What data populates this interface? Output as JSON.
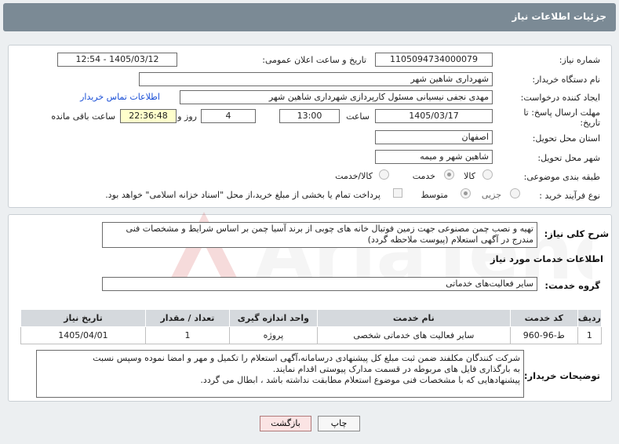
{
  "header": {
    "title": "جزئیات اطلاعات نیاز"
  },
  "fields": {
    "need_number_label": "شماره نیاز:",
    "need_number": "1105094734000079",
    "announce_label": "تاریخ و ساعت اعلان عمومی:",
    "announce_value": "1405/03/12 - 12:54",
    "buyer_org_label": "نام دستگاه خریدار:",
    "buyer_org": "شهرداری شاهین شهر",
    "creator_label": "ایجاد کننده درخواست:",
    "creator": "مهدی نجفی نیسیانی مسئول کارپردازی شهرداری شاهین شهر",
    "contact_link": "اطلاعات تماس خریدار",
    "deadline_label": "مهلت ارسال پاسخ: تا تاریخ:",
    "deadline_date": "1405/03/17",
    "time_label": "ساعت",
    "deadline_time": "13:00",
    "days_value": "4",
    "days_label": "روز و",
    "remaining_time": "22:36:48",
    "remaining_label": "ساعت باقی مانده",
    "province_label": "استان محل تحویل:",
    "province": "اصفهان",
    "city_label": "شهر محل تحویل:",
    "city": "شاهین شهر و میمه",
    "category_label": "طبقه بندی موضوعی:",
    "category_options": [
      "کالا",
      "خدمت",
      "کالا/خدمت"
    ],
    "category_selected": "خدمت",
    "process_label": "نوع فرآیند خرید :",
    "process_options": [
      "جزیی",
      "متوسط"
    ],
    "process_selected": "متوسط",
    "treasury_note": "پرداخت تمام یا بخشی از مبلغ خرید،از محل \"اسناد خزانه اسلامی\" خواهد بود."
  },
  "summary": {
    "label": "شرح کلی نیاز:",
    "text": "تهیه و نصب چمن مصنوعی جهت زمین فوتبال خانه های چوبی از برند آسیا چمن بر اساس شرایط و مشخصات فنی مندرج در آگهی استعلام (پیوست ملاحظه گردد)"
  },
  "services": {
    "section_title": "اطلاعات خدمات مورد نیاز",
    "group_label": "گروه خدمت:",
    "group_value": "سایر فعالیت‌های خدماتی",
    "columns": [
      "ردیف",
      "کد خدمت",
      "نام خدمت",
      "واحد اندازه گیری",
      "تعداد / مقدار",
      "تاریخ نیاز"
    ],
    "rows": [
      [
        "1",
        "ط-96-960",
        "سایر فعالیت های خدماتی شخصی",
        "پروژه",
        "1",
        "1405/04/01"
      ]
    ]
  },
  "notes": {
    "label": "توضیحات خریدار:",
    "lines": [
      "شرکت کنندگان مکلفند ضمن ثبت مبلغ کل پیشنهادی درسامانه،آگهی استعلام را  تکمیل و مهر و امضا نموده وسپس نسبت",
      "به بارگذاری فایل های مربوطه در قسمت مدارک پیوستی اقدام نمایند.",
      "پیشنهادهایی که با مشخصات فنی موضوع استعلام مطابقت نداشته باشد ، ابطال می گردد."
    ]
  },
  "buttons": {
    "print": "چاپ",
    "back": "بازگشت"
  },
  "colors": {
    "header": "#7b8a95",
    "link": "#1a4fd6",
    "highlight": "#ffffcc"
  }
}
